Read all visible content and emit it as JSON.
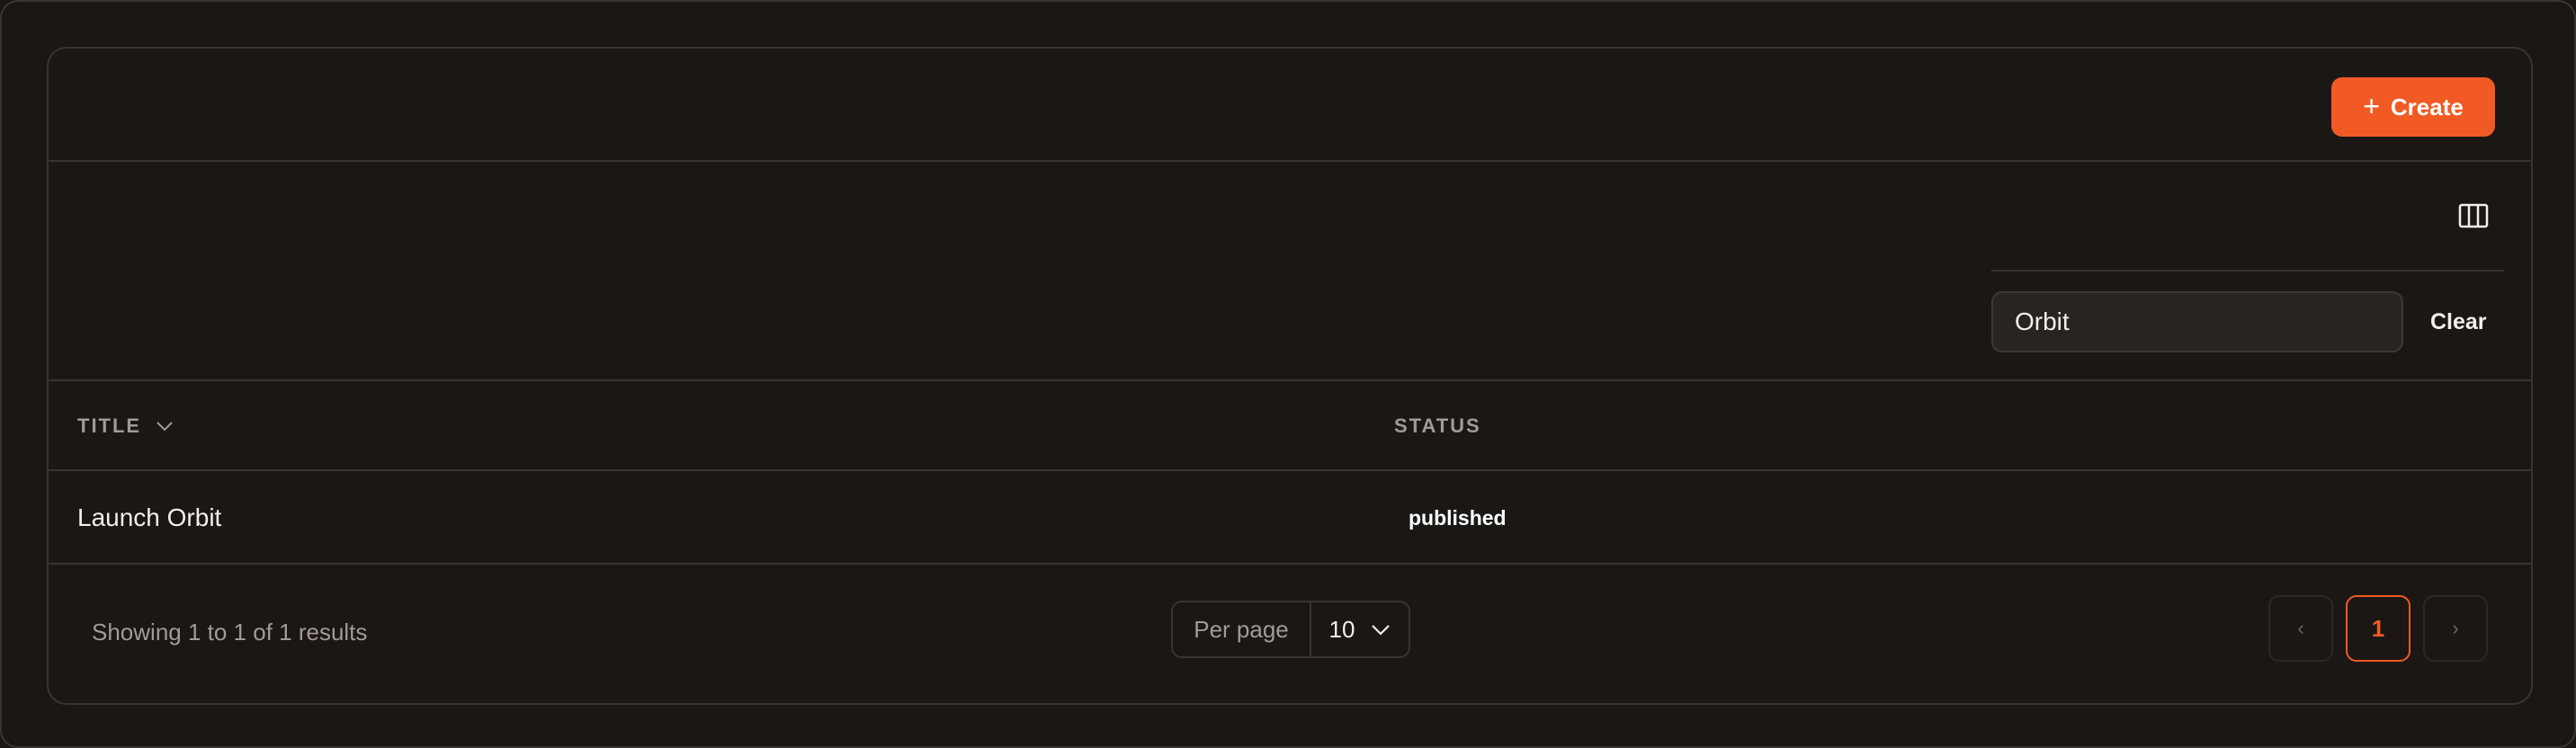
{
  "header": {
    "create_label": "Create",
    "create_icon": "plus-icon",
    "accent_color": "#f15a24"
  },
  "filters": {
    "columns_icon": "columns-icon",
    "search_value": "Orbit",
    "search_placeholder": "",
    "clear_label": "Clear"
  },
  "table": {
    "columns": [
      {
        "label": "TITLE",
        "sort_icon": "chevron-down-icon"
      },
      {
        "label": "STATUS"
      }
    ],
    "rows": [
      {
        "title": "Launch Orbit",
        "status": "published"
      }
    ]
  },
  "footer": {
    "results_text": "Showing 1 to 1 of 1 results",
    "per_page_label": "Per page",
    "per_page_value": "10",
    "pagination": {
      "prev": "‹",
      "current": "1",
      "next": "›"
    }
  }
}
